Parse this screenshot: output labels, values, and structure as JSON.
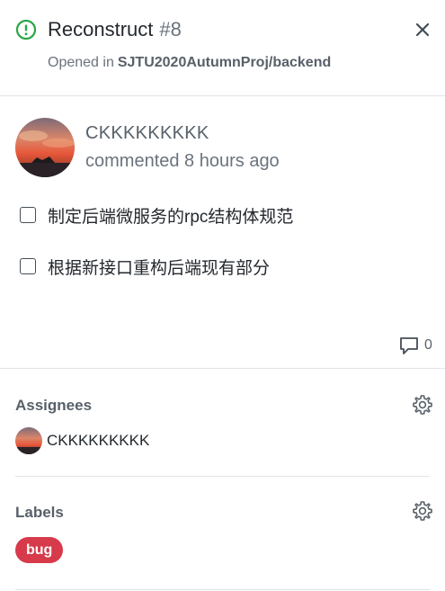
{
  "header": {
    "title": "Reconstruct",
    "issue_number": "#8",
    "opened_in_label": "Opened in",
    "repo": "SJTU2020AutumnProj/backend",
    "status": "open"
  },
  "comment": {
    "author": "CKKKKKKKKK",
    "meta": "commented 8 hours ago",
    "tasks": [
      {
        "text": "制定后端微服务的rpc结构体规范",
        "checked": false
      },
      {
        "text": "根据新接口重构后端现有部分",
        "checked": false
      }
    ],
    "comment_count": "0"
  },
  "assignees": {
    "title": "Assignees",
    "items": [
      {
        "name": "CKKKKKKKKK"
      }
    ]
  },
  "labels": {
    "title": "Labels",
    "items": [
      {
        "name": "bug",
        "color": "#d73a4a"
      }
    ]
  },
  "colors": {
    "open_green": "#28a745",
    "label_bug": "#d73a4a",
    "text_primary": "#24292e",
    "text_muted": "#6a737d",
    "border": "#e1e4e8"
  },
  "icons": {
    "status": "issue-opened-icon",
    "close": "close-icon",
    "comments": "comment-bubble-icon",
    "settings": "gear-icon"
  }
}
